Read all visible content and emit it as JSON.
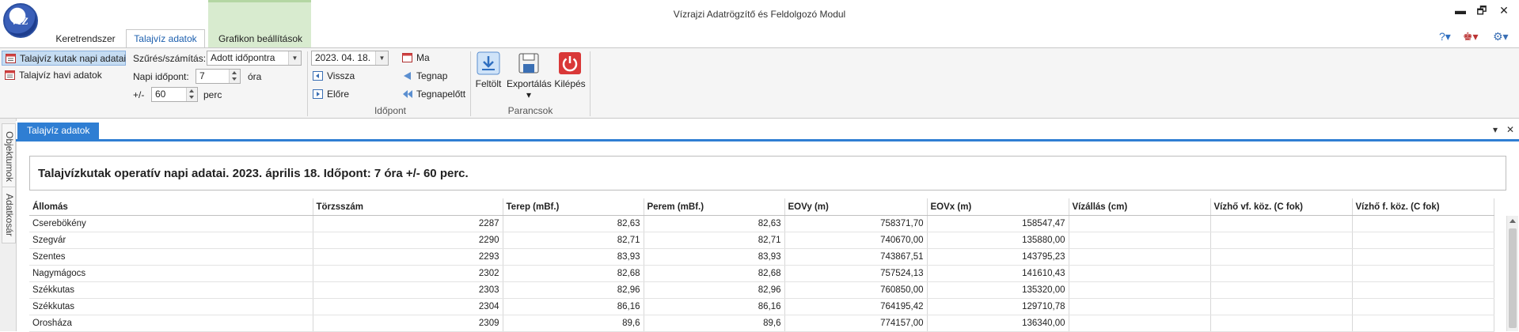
{
  "window": {
    "title": "Vízrajzi Adatrögzítő és Feldolgozó Modul",
    "logo_text": "VIZ",
    "minimize": "▬",
    "restore": "🗗",
    "close": "✕"
  },
  "ribbon_tabs": [
    {
      "label": "Keretrendszer",
      "active": false
    },
    {
      "label": "Talajvíz adatok",
      "active": true
    },
    {
      "label": "Grafikon beállítások",
      "active": false
    }
  ],
  "top_right_icons": [
    "help-icon",
    "user-icon",
    "settings-icon"
  ],
  "nav": {
    "items": [
      {
        "label": "Talajvíz kutak napi adatai",
        "selected": true
      },
      {
        "label": "Talajvíz havi adatok",
        "selected": false
      }
    ]
  },
  "filter": {
    "label": "Szűrés/számítás:",
    "value": "Adott időpontra",
    "time_label": "Napi időpont:",
    "time_value": "7",
    "time_unit": "óra",
    "tolerance_label": "+/-",
    "tolerance_value": "60",
    "tolerance_unit": "perc"
  },
  "date_group": {
    "date_value": "2023. 04. 18.",
    "back": "Vissza",
    "forward": "Előre",
    "today": "Ma",
    "yesterday": "Tegnap",
    "day_before": "Tegnapelőtt",
    "group_label": "Időpont"
  },
  "commands": {
    "upload": "Feltölt",
    "export": "Exportálás",
    "export_caret": "▾",
    "exit": "Kilépés",
    "group_label": "Parancsok"
  },
  "side_tabs": [
    "Objektumok",
    "Adatkosár"
  ],
  "document": {
    "tab_label": "Talajvíz adatok",
    "tab_menu": "▾",
    "tab_close": "✕"
  },
  "report": {
    "title": "Talajvízkutak operatív napi adatai. 2023. április 18. Időpont: 7 óra +/- 60 perc.",
    "columns": [
      "Állomás",
      "Törzsszám",
      "Terep (mBf.)",
      "Perem (mBf.)",
      "EOVy (m)",
      "EOVx (m)",
      "Vízállás (cm)",
      "Vízhő vf. köz. (C fok)",
      "Vízhő f. köz. (C fok)"
    ],
    "rows": [
      [
        "Cserebökény",
        "2287",
        "82,63",
        "82,63",
        "758371,70",
        "158547,47",
        "",
        "",
        ""
      ],
      [
        "Szegvár",
        "2290",
        "82,71",
        "82,71",
        "740670,00",
        "135880,00",
        "",
        "",
        ""
      ],
      [
        "Szentes",
        "2293",
        "83,93",
        "83,93",
        "743867,51",
        "143795,23",
        "",
        "",
        ""
      ],
      [
        "Nagymágocs",
        "2302",
        "82,68",
        "82,68",
        "757524,13",
        "141610,43",
        "",
        "",
        ""
      ],
      [
        "Székkutas",
        "2303",
        "82,96",
        "82,96",
        "760850,00",
        "135320,00",
        "",
        "",
        ""
      ],
      [
        "Székkutas",
        "2304",
        "86,16",
        "86,16",
        "764195,42",
        "129710,78",
        "",
        "",
        ""
      ],
      [
        "Orosháza",
        "2309",
        "89,6",
        "89,6",
        "774157,00",
        "136340,00",
        "",
        "",
        ""
      ]
    ]
  }
}
